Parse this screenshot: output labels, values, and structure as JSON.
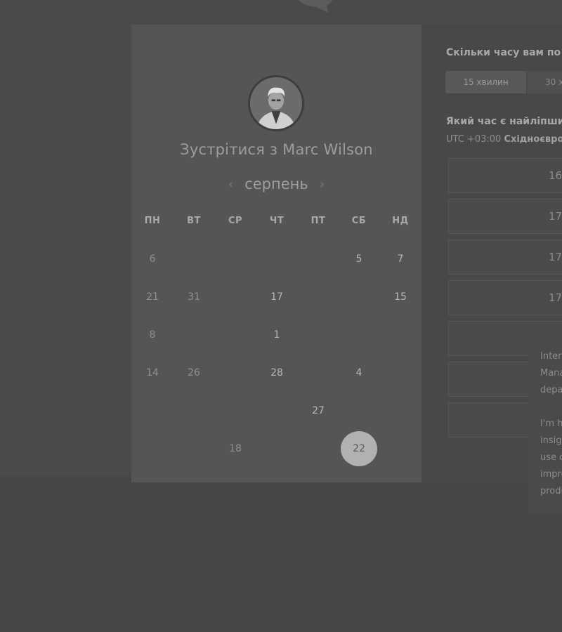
{
  "logo": {
    "icon": "speech-bubble-logo"
  },
  "calendar": {
    "title": "Зустрітися з Marc Wilson",
    "month": "серпень",
    "prev_icon": "chevron-left-icon",
    "next_icon": "chevron-right-icon",
    "weekdays": [
      "ПН",
      "ВТ",
      "СР",
      "ЧТ",
      "ПТ",
      "СБ",
      "НД"
    ],
    "rows": [
      [
        "6",
        "",
        "",
        "",
        "",
        "5",
        "7"
      ],
      [
        "21",
        "31",
        "",
        "17",
        "",
        "",
        "15"
      ],
      [
        "8",
        "",
        "",
        "1",
        "",
        "",
        ""
      ],
      [
        "14",
        "26",
        "",
        "28",
        "",
        "4",
        ""
      ],
      [
        "",
        "",
        "",
        "",
        "27",
        "",
        ""
      ],
      [
        "",
        "",
        "18",
        "",
        "",
        "22",
        ""
      ]
    ],
    "selected": "22"
  },
  "duration": {
    "question": "Скільки часу вам по",
    "options": [
      "15 хвилин",
      "30 х"
    ]
  },
  "time": {
    "question": "Який час є найліпши",
    "timezone_offset": "UTC +03:00",
    "timezone_name": "Східноєвро",
    "slots": [
      "16",
      "17",
      "17",
      "17",
      "",
      "",
      ""
    ]
  },
  "popup": {
    "lines": [
      "Interc",
      "Mana",
      "depa",
      "",
      "I'm h",
      "insig",
      "use c",
      "impro",
      "produ"
    ]
  }
}
